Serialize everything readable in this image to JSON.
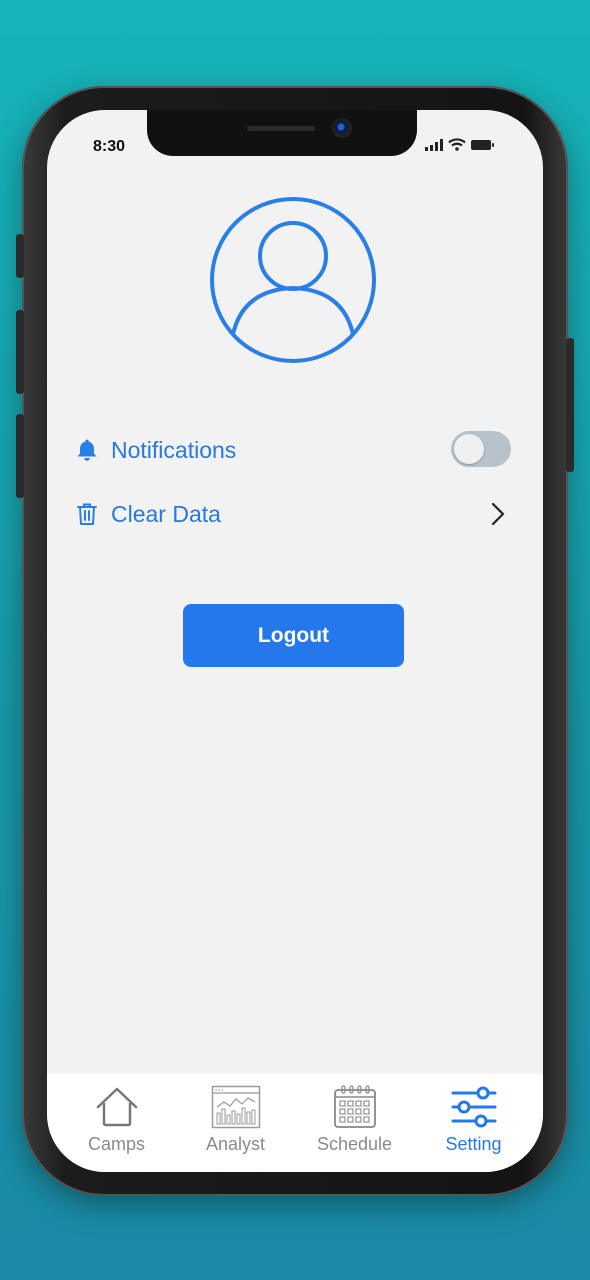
{
  "status_bar": {
    "time": "8:30"
  },
  "settings": {
    "notifications_label": "Notifications",
    "notifications_enabled": false,
    "clear_data_label": "Clear Data"
  },
  "logout_label": "Logout",
  "tabs": [
    {
      "label": "Camps",
      "icon": "home-icon",
      "active": false
    },
    {
      "label": "Analyst",
      "icon": "analytics-chart-icon",
      "active": false
    },
    {
      "label": "Schedule",
      "icon": "calendar-icon",
      "active": false
    },
    {
      "label": "Setting",
      "icon": "sliders-icon",
      "active": true
    }
  ],
  "colors": {
    "accent": "#2578ec",
    "label_blue": "#2878e0",
    "inactive_tab": "#8a8a8a",
    "screen_bg": "#f2f2f2"
  }
}
